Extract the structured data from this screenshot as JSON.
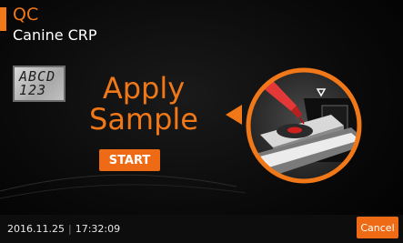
{
  "header": {
    "title": "QC",
    "subtitle": "Canine CRP"
  },
  "sample_card": {
    "line1": "ABCD",
    "line2": "123"
  },
  "instruction": {
    "line1": "Apply",
    "line2": "Sample"
  },
  "actions": {
    "start_label": "START",
    "cancel_label": "Cancel"
  },
  "status": {
    "date": "2016.11.25",
    "time": "17:32:09"
  },
  "colors": {
    "accent": "#f07818",
    "button": "#ee6a14",
    "background": "#000000",
    "text": "#ffffff"
  },
  "icons": {
    "illustration": "apply-sample-pipette-illustration-icon"
  }
}
